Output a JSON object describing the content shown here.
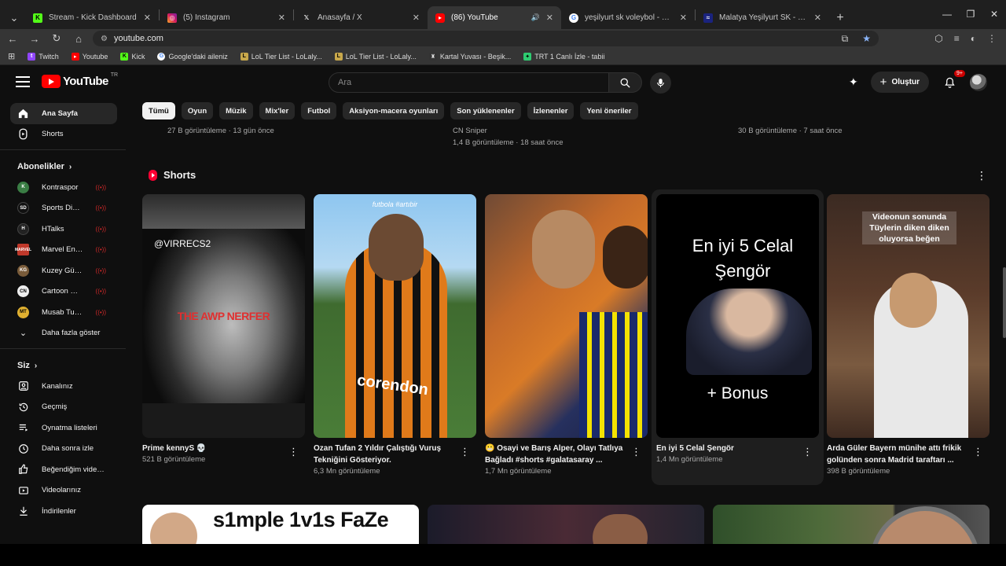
{
  "browser": {
    "tabs": [
      {
        "title": "Stream - Kick Dashboard",
        "icon": "kick-icon",
        "active": false
      },
      {
        "title": "(5) Instagram",
        "icon": "instagram-icon",
        "active": false
      },
      {
        "title": "Anasayfa / X",
        "icon": "x-icon",
        "active": false
      },
      {
        "title": "(86) YouTube",
        "icon": "youtube-icon",
        "active": true
      },
      {
        "title": "yeşilyurt sk voleybol - Google'd",
        "icon": "google-icon",
        "active": false
      },
      {
        "title": "Malatya Yeşilyurt SK - Kulüp pr",
        "icon": "club-icon",
        "active": false
      }
    ],
    "url": "youtube.com",
    "bookmarks": [
      {
        "label": "Twitch",
        "color": "#9146ff"
      },
      {
        "label": "Youtube",
        "color": "#ff0000"
      },
      {
        "label": "Kick",
        "color": "#53fc18"
      },
      {
        "label": "Google'daki aileniz",
        "color": "#4285f4"
      },
      {
        "label": "LoL Tier List - LoLaly...",
        "color": "#c8a84b"
      },
      {
        "label": "LoL Tier List - LoLaly...",
        "color": "#c8a84b"
      },
      {
        "label": "Kartal Yuvası - Beşik...",
        "color": "#dddddd"
      },
      {
        "label": "TRT 1 Canlı İzle - tabii",
        "color": "#2ecc71"
      }
    ]
  },
  "header": {
    "logo_text": "YouTube",
    "region": "TR",
    "search_placeholder": "Ara",
    "create_label": "Oluştur",
    "notification_count": "9+"
  },
  "sidebar": {
    "main": [
      {
        "label": "Ana Sayfa",
        "icon": "home-icon",
        "active": true
      },
      {
        "label": "Shorts",
        "icon": "shorts-icon",
        "active": false
      }
    ],
    "subscriptions_title": "Abonelikler",
    "subscriptions": [
      {
        "label": "Kontraspor",
        "abbr": "K",
        "color": "#3a7d44"
      },
      {
        "label": "Sports Digitale",
        "abbr": "SD",
        "color": "#111111"
      },
      {
        "label": "HTalks",
        "abbr": "H",
        "color": "#222222"
      },
      {
        "label": "Marvel Entertain...",
        "abbr": "M",
        "color": "#c0392b"
      },
      {
        "label": "Kuzey Güney",
        "abbr": "KG",
        "color": "#7a5c3a"
      },
      {
        "label": "Cartoon Network...",
        "abbr": "CN",
        "color": "#eeeeee"
      },
      {
        "label": "Musab Tuana",
        "abbr": "MT",
        "color": "#e0b030"
      }
    ],
    "show_more": "Daha fazla göster",
    "you_title": "Siz",
    "you_items": [
      {
        "label": "Kanalınız",
        "icon": "channel-icon"
      },
      {
        "label": "Geçmiş",
        "icon": "history-icon"
      },
      {
        "label": "Oynatma listeleri",
        "icon": "playlist-icon"
      },
      {
        "label": "Daha sonra izle",
        "icon": "watch-later-icon"
      },
      {
        "label": "Beğendiğim videolar",
        "icon": "like-icon"
      },
      {
        "label": "Videolarınız",
        "icon": "your-videos-icon"
      },
      {
        "label": "İndirilenler",
        "icon": "download-icon"
      }
    ]
  },
  "chips": [
    "Tümü",
    "Oyun",
    "Müzik",
    "Mix'ler",
    "Futbol",
    "Aksiyon-macera oyunları",
    "Son yüklenenler",
    "İzlenenler",
    "Yeni öneriler"
  ],
  "previous_row": [
    {
      "line1": "27 B görüntüleme · 13 gün önce",
      "line2": ""
    },
    {
      "line1": "CN Sniper",
      "line2": "1,4 B görüntüleme · 18 saat önce"
    },
    {
      "line1": "30 B görüntüleme · 7 saat önce",
      "line2": ""
    }
  ],
  "shorts": {
    "section_title": "Shorts",
    "items": [
      {
        "title": "Prime kennyS 💀",
        "views": "521 B görüntüleme",
        "overlay_top": "@VIRRECS2",
        "overlay_mid": "THE AWP NERFER"
      },
      {
        "title": "Ozan Tufan 2 Yıldır Çalıştığı Vuruş Tekniğini Gösteriyor.",
        "views": "6,3 Mn görüntüleme",
        "overlay_top": "futbola #artıbir",
        "overlay_mid": "corendon"
      },
      {
        "title": "😬 Osayi ve Barış Alper, Olayı Tatlıya Bağladı #shorts #galatasaray ...",
        "views": "1,7 Mn görüntüleme",
        "overlay_top": "",
        "overlay_mid": ""
      },
      {
        "title": "En iyi 5 Celal Şengör",
        "views": "1,4 Mn görüntüleme",
        "overlay_top": "En iyi 5 Celal Şengör",
        "overlay_mid": "+ Bonus"
      },
      {
        "title": "Arda Güler Bayern münihe attı frikik golünden sonra Madrid taraftarı ...",
        "views": "398 B görüntüleme",
        "overlay_top": "Videonun sonunda Tüylerin diken diken oluyorsa beğen",
        "overlay_mid": ""
      }
    ]
  },
  "next_row": [
    {
      "overlay": "s1mple 1v1s FaZe"
    }
  ]
}
